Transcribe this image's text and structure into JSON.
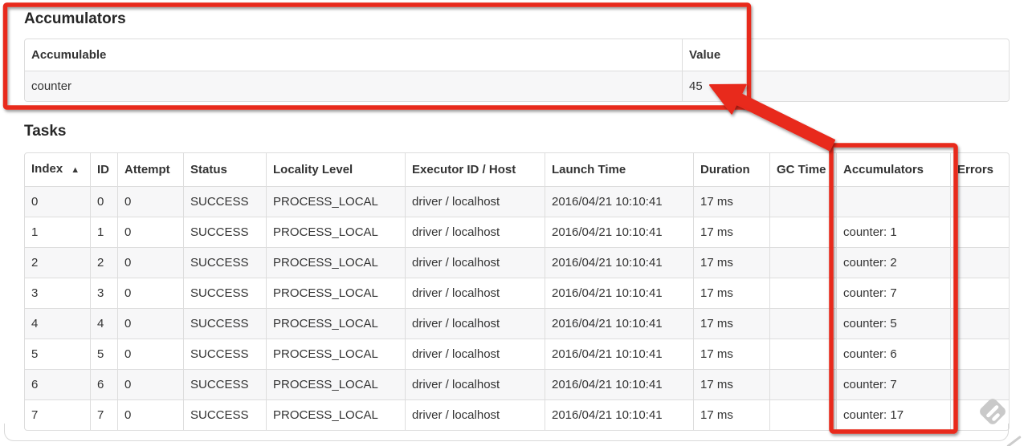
{
  "accumulators_section": {
    "title": "Accumulators",
    "table": {
      "headers": {
        "accumulable": "Accumulable",
        "value": "Value"
      },
      "rows": [
        {
          "accumulable": "counter",
          "value": "45"
        }
      ]
    }
  },
  "tasks_section": {
    "title": "Tasks",
    "table": {
      "headers": {
        "index": "Index",
        "sort_icon": "▲",
        "id": "ID",
        "attempt": "Attempt",
        "status": "Status",
        "locality_level": "Locality Level",
        "executor_id_host": "Executor ID / Host",
        "launch_time": "Launch Time",
        "duration": "Duration",
        "gc_time": "GC Time",
        "accumulators": "Accumulators",
        "errors": "Errors"
      },
      "rows": [
        {
          "index": "0",
          "id": "0",
          "attempt": "0",
          "status": "SUCCESS",
          "locality_level": "PROCESS_LOCAL",
          "executor_id_host": "driver / localhost",
          "launch_time": "2016/04/21 10:10:41",
          "duration": "17 ms",
          "gc_time": "",
          "accumulators": "",
          "errors": ""
        },
        {
          "index": "1",
          "id": "1",
          "attempt": "0",
          "status": "SUCCESS",
          "locality_level": "PROCESS_LOCAL",
          "executor_id_host": "driver / localhost",
          "launch_time": "2016/04/21 10:10:41",
          "duration": "17 ms",
          "gc_time": "",
          "accumulators": "counter: 1",
          "errors": ""
        },
        {
          "index": "2",
          "id": "2",
          "attempt": "0",
          "status": "SUCCESS",
          "locality_level": "PROCESS_LOCAL",
          "executor_id_host": "driver / localhost",
          "launch_time": "2016/04/21 10:10:41",
          "duration": "17 ms",
          "gc_time": "",
          "accumulators": "counter: 2",
          "errors": ""
        },
        {
          "index": "3",
          "id": "3",
          "attempt": "0",
          "status": "SUCCESS",
          "locality_level": "PROCESS_LOCAL",
          "executor_id_host": "driver / localhost",
          "launch_time": "2016/04/21 10:10:41",
          "duration": "17 ms",
          "gc_time": "",
          "accumulators": "counter: 7",
          "errors": ""
        },
        {
          "index": "4",
          "id": "4",
          "attempt": "0",
          "status": "SUCCESS",
          "locality_level": "PROCESS_LOCAL",
          "executor_id_host": "driver / localhost",
          "launch_time": "2016/04/21 10:10:41",
          "duration": "17 ms",
          "gc_time": "",
          "accumulators": "counter: 5",
          "errors": ""
        },
        {
          "index": "5",
          "id": "5",
          "attempt": "0",
          "status": "SUCCESS",
          "locality_level": "PROCESS_LOCAL",
          "executor_id_host": "driver / localhost",
          "launch_time": "2016/04/21 10:10:41",
          "duration": "17 ms",
          "gc_time": "",
          "accumulators": "counter: 6",
          "errors": ""
        },
        {
          "index": "6",
          "id": "6",
          "attempt": "0",
          "status": "SUCCESS",
          "locality_level": "PROCESS_LOCAL",
          "executor_id_host": "driver / localhost",
          "launch_time": "2016/04/21 10:10:41",
          "duration": "17 ms",
          "gc_time": "",
          "accumulators": "counter: 7",
          "errors": ""
        },
        {
          "index": "7",
          "id": "7",
          "attempt": "0",
          "status": "SUCCESS",
          "locality_level": "PROCESS_LOCAL",
          "executor_id_host": "driver / localhost",
          "launch_time": "2016/04/21 10:10:41",
          "duration": "17 ms",
          "gc_time": "",
          "accumulators": "counter: 17",
          "errors": ""
        }
      ]
    }
  },
  "annotations": {
    "highlight_color": "#e8291c"
  },
  "watermark": {
    "color": "#c9c9c9"
  }
}
